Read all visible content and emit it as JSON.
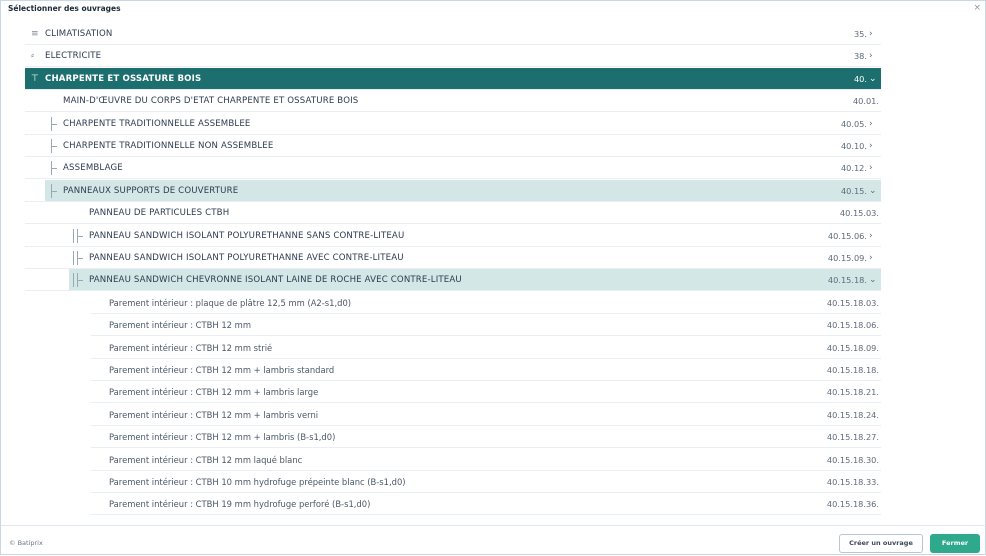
{
  "window": {
    "title": "Sélectionner des ouvrages",
    "close_label": "×"
  },
  "colors": {
    "selected_bg": "#1d6e6e",
    "expanded_bg": "#d3e7e7",
    "accent": "#2ea98c"
  },
  "rows": [
    {
      "level": 0,
      "icon": "≡",
      "icon_name": "climatisation-icon",
      "label": "CLIMATISATION",
      "code": "35.",
      "chevron": "›",
      "state": "collapsed"
    },
    {
      "level": 0,
      "icon": "⸗",
      "icon_name": "electricite-icon",
      "label": "ELECTRICITE",
      "code": "38.",
      "chevron": "›",
      "state": "collapsed"
    },
    {
      "level": 0,
      "icon": "⊤",
      "icon_name": "charpente-icon",
      "label": "CHARPENTE ET OSSATURE BOIS",
      "code": "40.",
      "chevron": "⌄",
      "state": "selected"
    },
    {
      "level": 1,
      "label": "MAIN-D'ŒUVRE DU CORPS D'ETAT CHARPENTE ET OSSATURE BOIS",
      "code": "40.01.",
      "chevron": "",
      "state": "leaf"
    },
    {
      "level": 1,
      "label": "CHARPENTE TRADITIONNELLE ASSEMBLEE",
      "code": "40.05.",
      "chevron": "›",
      "state": "collapsed"
    },
    {
      "level": 1,
      "label": "CHARPENTE TRADITIONNELLE NON ASSEMBLEE",
      "code": "40.10.",
      "chevron": "›",
      "state": "collapsed"
    },
    {
      "level": 1,
      "label": "ASSEMBLAGE",
      "code": "40.12.",
      "chevron": "›",
      "state": "collapsed"
    },
    {
      "level": 1,
      "label": "PANNEAUX SUPPORTS DE COUVERTURE",
      "code": "40.15.",
      "chevron": "⌄",
      "state": "expanded"
    },
    {
      "level": 2,
      "label": "PANNEAU DE PARTICULES CTBH",
      "code": "40.15.03.",
      "chevron": "",
      "state": "leaf"
    },
    {
      "level": 2,
      "label": "PANNEAU SANDWICH ISOLANT POLYURETHANNE SANS CONTRE-LITEAU",
      "code": "40.15.06.",
      "chevron": "›",
      "state": "collapsed"
    },
    {
      "level": 2,
      "label": "PANNEAU SANDWICH ISOLANT POLYURETHANNE AVEC CONTRE-LITEAU",
      "code": "40.15.09.",
      "chevron": "›",
      "state": "collapsed"
    },
    {
      "level": 2,
      "label": "PANNEAU SANDWICH CHEVRONNE ISOLANT LAINE DE ROCHE AVEC CONTRE-LITEAU",
      "code": "40.15.18.",
      "chevron": "⌄",
      "state": "expanded"
    },
    {
      "level": 3,
      "label": "Parement intérieur : plaque de plâtre 12,5 mm (A2-s1,d0)",
      "code": "40.15.18.03.",
      "chevron": "",
      "state": "leaf"
    },
    {
      "level": 3,
      "label": "Parement intérieur : CTBH 12 mm",
      "code": "40.15.18.06.",
      "chevron": "",
      "state": "leaf"
    },
    {
      "level": 3,
      "label": "Parement intérieur : CTBH 12 mm strié",
      "code": "40.15.18.09.",
      "chevron": "",
      "state": "leaf"
    },
    {
      "level": 3,
      "label": "Parement intérieur : CTBH 12 mm + lambris standard",
      "code": "40.15.18.18.",
      "chevron": "",
      "state": "leaf"
    },
    {
      "level": 3,
      "label": "Parement intérieur : CTBH 12 mm + lambris large",
      "code": "40.15.18.21.",
      "chevron": "",
      "state": "leaf"
    },
    {
      "level": 3,
      "label": "Parement intérieur : CTBH 12 mm + lambris verni",
      "code": "40.15.18.24.",
      "chevron": "",
      "state": "leaf"
    },
    {
      "level": 3,
      "label": "Parement intérieur : CTBH 12 mm + lambris (B-s1,d0)",
      "code": "40.15.18.27.",
      "chevron": "",
      "state": "leaf"
    },
    {
      "level": 3,
      "label": "Parement intérieur : CTBH 12 mm laqué blanc",
      "code": "40.15.18.30.",
      "chevron": "",
      "state": "leaf"
    },
    {
      "level": 3,
      "label": "Parement intérieur : CTBH 10 mm hydrofuge prépeinte blanc (B-s1,d0)",
      "code": "40.15.18.33.",
      "chevron": "",
      "state": "leaf"
    },
    {
      "level": 3,
      "label": "Parement intérieur : CTBH 19 mm hydrofuge perforé (B-s1,d0)",
      "code": "40.15.18.36.",
      "chevron": "",
      "state": "leaf"
    }
  ],
  "footer": {
    "brand": "© Batiprix",
    "create_label": "Créer un ouvrage",
    "close_label": "Fermer"
  }
}
